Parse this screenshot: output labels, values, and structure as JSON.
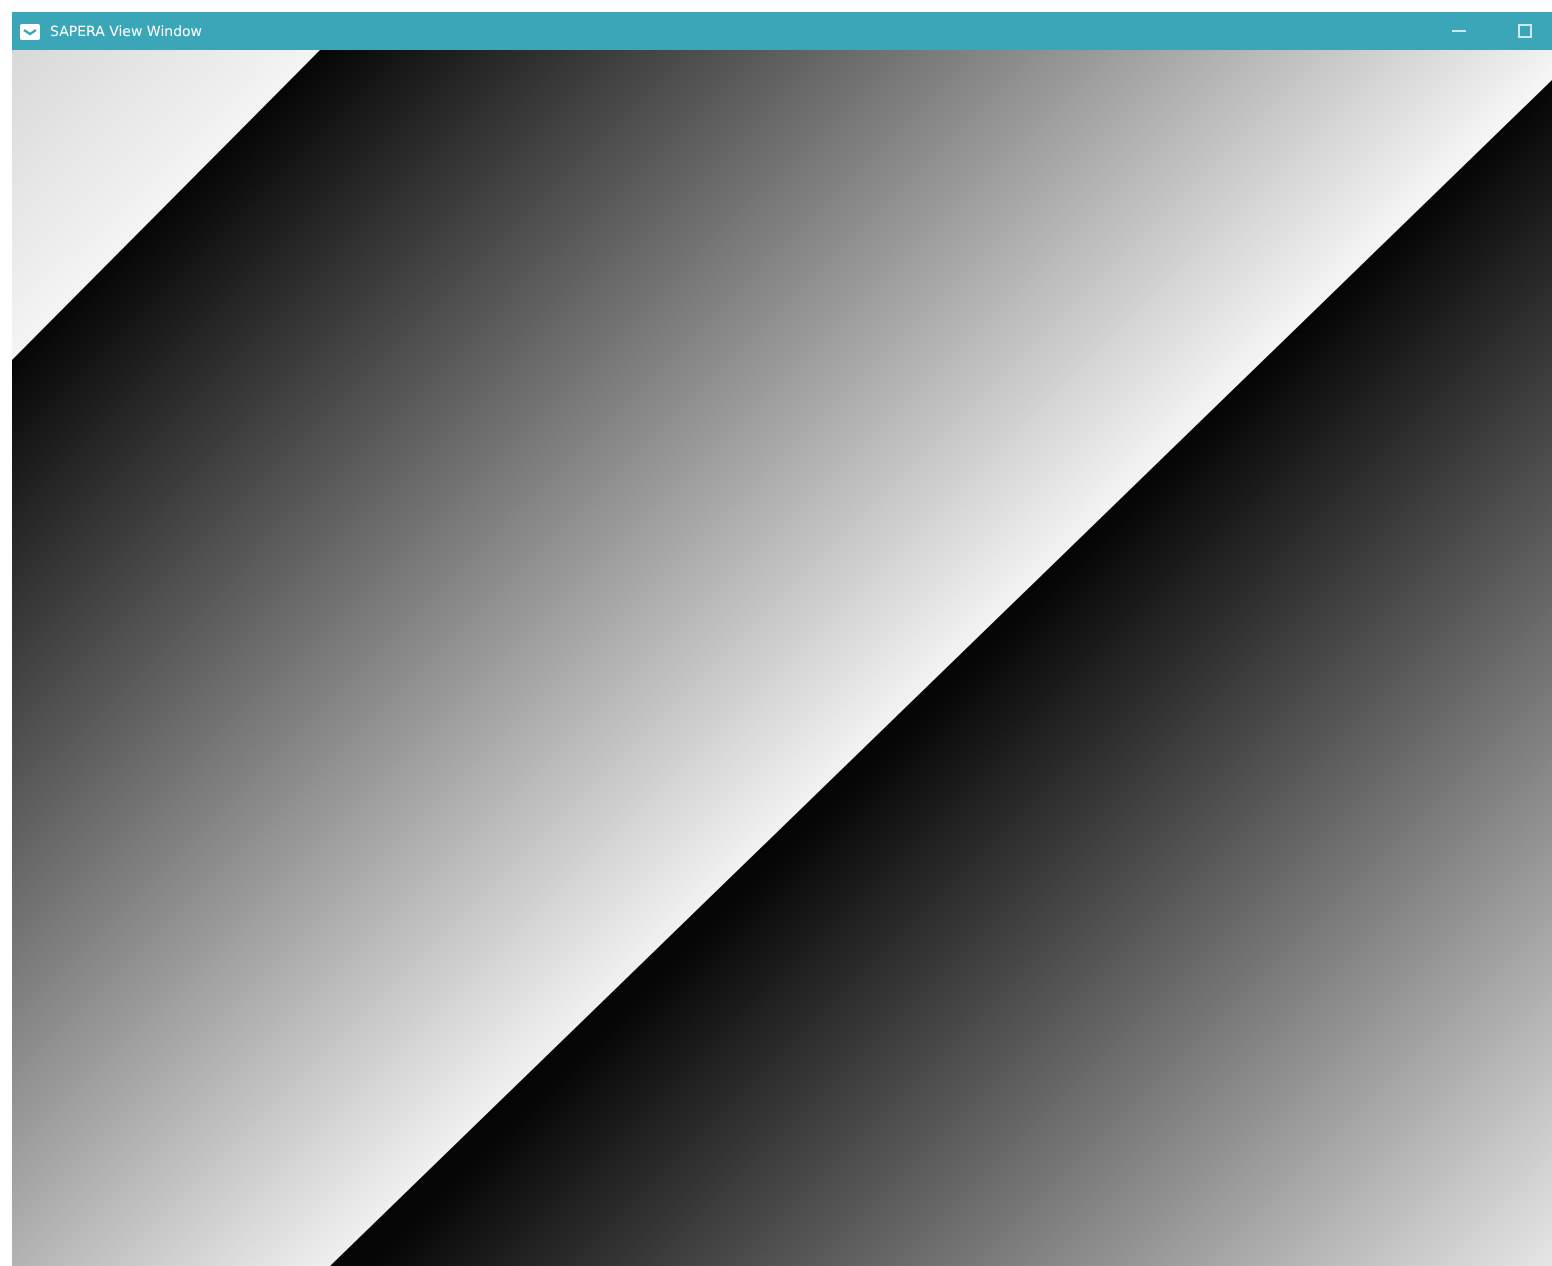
{
  "window": {
    "title": "SAPERA View Window"
  }
}
